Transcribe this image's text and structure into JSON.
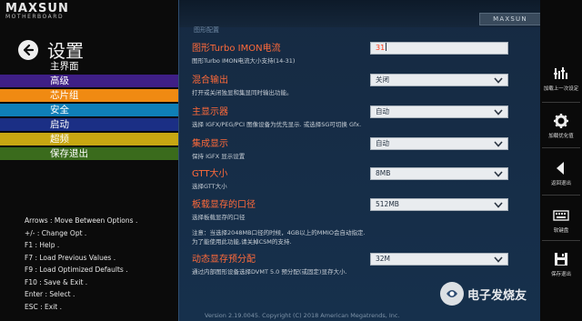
{
  "brand": {
    "name": "MAXSUN",
    "sub": "MOTHERBOARD"
  },
  "header": {
    "title": "设置",
    "breadcrumb": "图形配置",
    "brand_box": "MAXSUN"
  },
  "menu": {
    "items": [
      {
        "label": "主界面",
        "color": "#0b0b0b"
      },
      {
        "label": "高级",
        "color": "#3f1f86"
      },
      {
        "label": "芯片组",
        "color": "#f08a12"
      },
      {
        "label": "安全",
        "color": "#0f7fb8"
      },
      {
        "label": "启动",
        "color": "#1b2f85"
      },
      {
        "label": "超频",
        "color": "#c8a712"
      },
      {
        "label": "保存退出",
        "color": "#3a6b1c"
      }
    ]
  },
  "help": [
    "Arrows : Move Between Options .",
    "+/- : Change Opt .",
    "F1 : Help .",
    "F7 : Load Previous Values .",
    "F9 : Load Optimized Defaults .",
    "F10 : Save & Exit .",
    "Enter : Select .",
    "ESC : Exit ."
  ],
  "settings": [
    {
      "label": "图形Turbo IMON电流",
      "desc": "图形Turbo IMON电流大小支持(14-31)",
      "value": "31",
      "type": "input"
    },
    {
      "label": "混合输出",
      "desc": "打开或关闭独显和集显同时输出功能。",
      "value": "关闭",
      "type": "select"
    },
    {
      "label": "主显示器",
      "desc": "选择 IGFX/PEG/PCI 图像设备为优先显示. 或选择SG可切换 Gfx.",
      "value": "自动",
      "type": "select"
    },
    {
      "label": "集成显示",
      "desc": "保持 IGFX 显示设置",
      "value": "自动",
      "type": "select"
    },
    {
      "label": "GTT大小",
      "desc": "选择GTT大小",
      "value": "8MB",
      "type": "select"
    },
    {
      "label": "板载显存的口径",
      "desc": "选择板载显存的口径",
      "value": "512MB",
      "type": "select"
    },
    {
      "label": "动态显存预分配",
      "desc": "通过内部图形设备选择DVMT 5.0 预分配(或固定)显存大小.",
      "value": "32M",
      "type": "select"
    }
  ],
  "note": {
    "line1": "注意：当选择2048MB口径的时候，4GB以上的MMIO会自动指定.",
    "line2": "为了能使用此功能,请关掉CSM的支持."
  },
  "footer": "Version 2.19.0045. Copyright (C) 2018 American Megatrends, Inc.",
  "sidebar": {
    "tools": [
      {
        "label": "加载上一次设定",
        "icon": "load-previous-icon"
      },
      {
        "label": "加载优化值",
        "icon": "gear-icon"
      },
      {
        "label": "返回退出",
        "icon": "back-arrow-icon"
      },
      {
        "label": "软键盘",
        "icon": "keyboard-icon"
      },
      {
        "label": "保存退出",
        "icon": "save-icon"
      }
    ]
  },
  "watermark": {
    "text": "电子发烧友"
  }
}
